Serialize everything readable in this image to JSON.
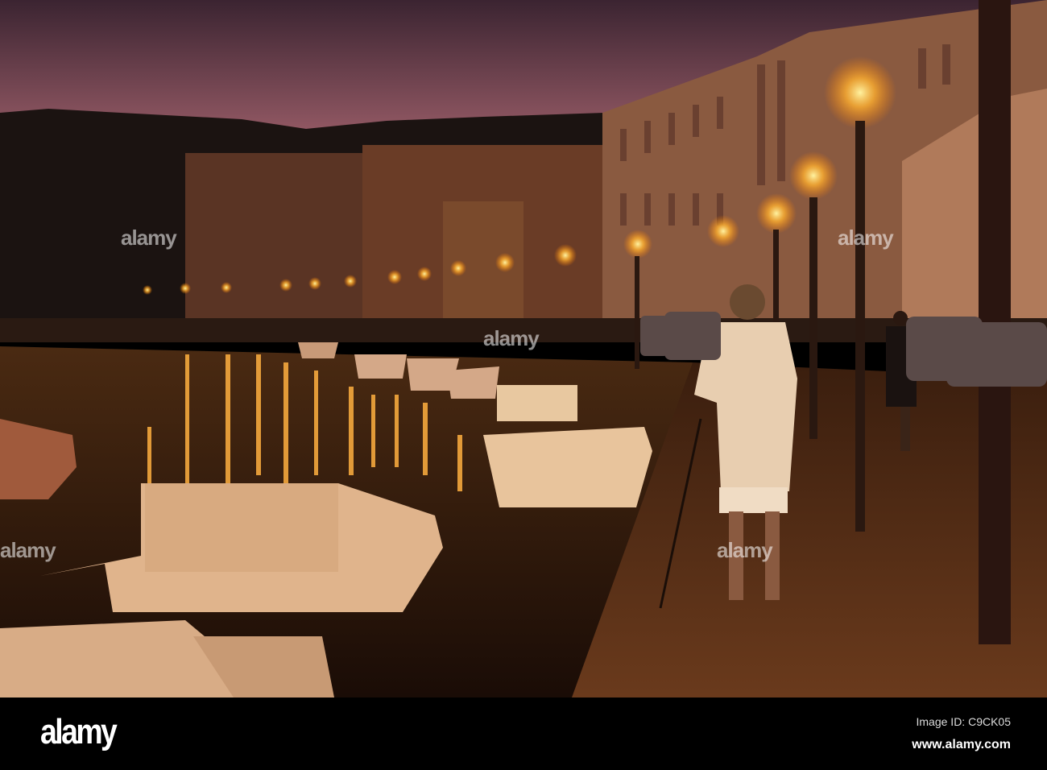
{
  "photo": {
    "watermark": "alamy",
    "palette": {
      "sky_top": "#3a2230",
      "sky_bottom": "#c2797c",
      "hill": "#1a1210",
      "lamp": "#ffb030",
      "water": "#2a1508"
    }
  },
  "footer": {
    "logo": "alamy",
    "image_id": "Image ID: C9CK05",
    "url": "www.alamy.com"
  }
}
